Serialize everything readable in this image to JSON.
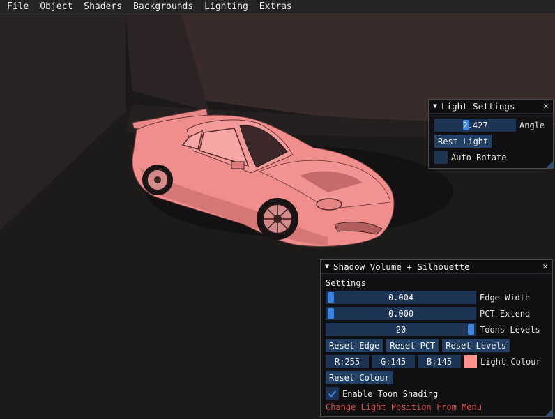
{
  "menubar": {
    "items": [
      "File",
      "Object",
      "Shaders",
      "Backgrounds",
      "Lighting",
      "Extras"
    ]
  },
  "light_window": {
    "title": "Light Settings",
    "angle_value": "2.427",
    "angle_label": "Angle",
    "reset_label": "Rest Light",
    "auto_rotate_label": "Auto Rotate",
    "auto_rotate_checked": false
  },
  "shadow_window": {
    "title": "Shadow Volume + Silhouette",
    "settings_header": "Settings",
    "edge_width": {
      "value": "0.004",
      "label": "Edge Width",
      "fraction": 0.0
    },
    "pct_extend": {
      "value": "0.000",
      "label": "PCT Extend",
      "fraction": 0.0
    },
    "toon_levels": {
      "value": "20",
      "label": "Toons Levels",
      "fraction": 1.0
    },
    "reset_edge_label": "Reset Edge",
    "reset_pct_label": "Reset PCT",
    "reset_levels_label": "Reset Levels",
    "colour_r": "R:255",
    "colour_g": "G:145",
    "colour_b": "B:145",
    "colour_label": "Light Colour",
    "light_colour_hex": "#ff9191",
    "reset_colour_label": "Reset Colour",
    "toon_shading_label": "Enable Toon Shading",
    "toon_shading_checked": true,
    "hint_text": "Change Light Position From Menu"
  },
  "colors": {
    "accent": "#3d85e0",
    "frame_bg": "#1e3454",
    "button_bg": "#224066",
    "car_body": "#f08e8e",
    "hint_red": "#dc4a4a"
  }
}
